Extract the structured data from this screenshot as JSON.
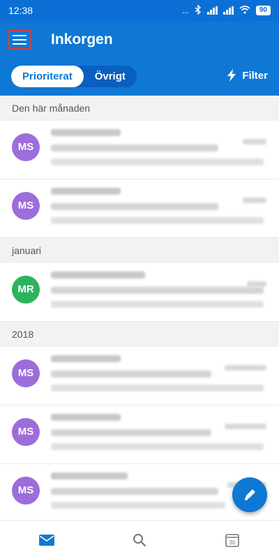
{
  "status_bar": {
    "time": "12:38",
    "dots": "...",
    "battery": "90"
  },
  "header": {
    "title": "Inkorgen"
  },
  "tabs": [
    {
      "label": "Prioriterat",
      "active": true
    },
    {
      "label": "Övrigt",
      "active": false
    }
  ],
  "filter": {
    "label": "Filter",
    "icon": "lightning-icon"
  },
  "sections": [
    {
      "header": "Den här månaden",
      "items": [
        {
          "avatar": "MS",
          "color": "#9c6ddb"
        },
        {
          "avatar": "MS",
          "color": "#9c6ddb"
        }
      ]
    },
    {
      "header": "januari",
      "items": [
        {
          "avatar": "MR",
          "color": "#2db35e"
        }
      ]
    },
    {
      "header": "2018",
      "items": [
        {
          "avatar": "MS",
          "color": "#9c6ddb"
        },
        {
          "avatar": "MS",
          "color": "#9c6ddb"
        },
        {
          "avatar": "MS",
          "color": "#9c6ddb"
        }
      ]
    }
  ],
  "bottom_nav": {
    "mail_icon": "mail-icon",
    "search_icon": "search-icon",
    "calendar_icon": "calendar-icon",
    "calendar_day": "30"
  },
  "fab": {
    "icon": "compose-icon"
  },
  "colors": {
    "accent": "#0f78d4",
    "status_bar": "#0b6fd6",
    "avatar_purple": "#9c6ddb",
    "avatar_green": "#2db35e"
  }
}
